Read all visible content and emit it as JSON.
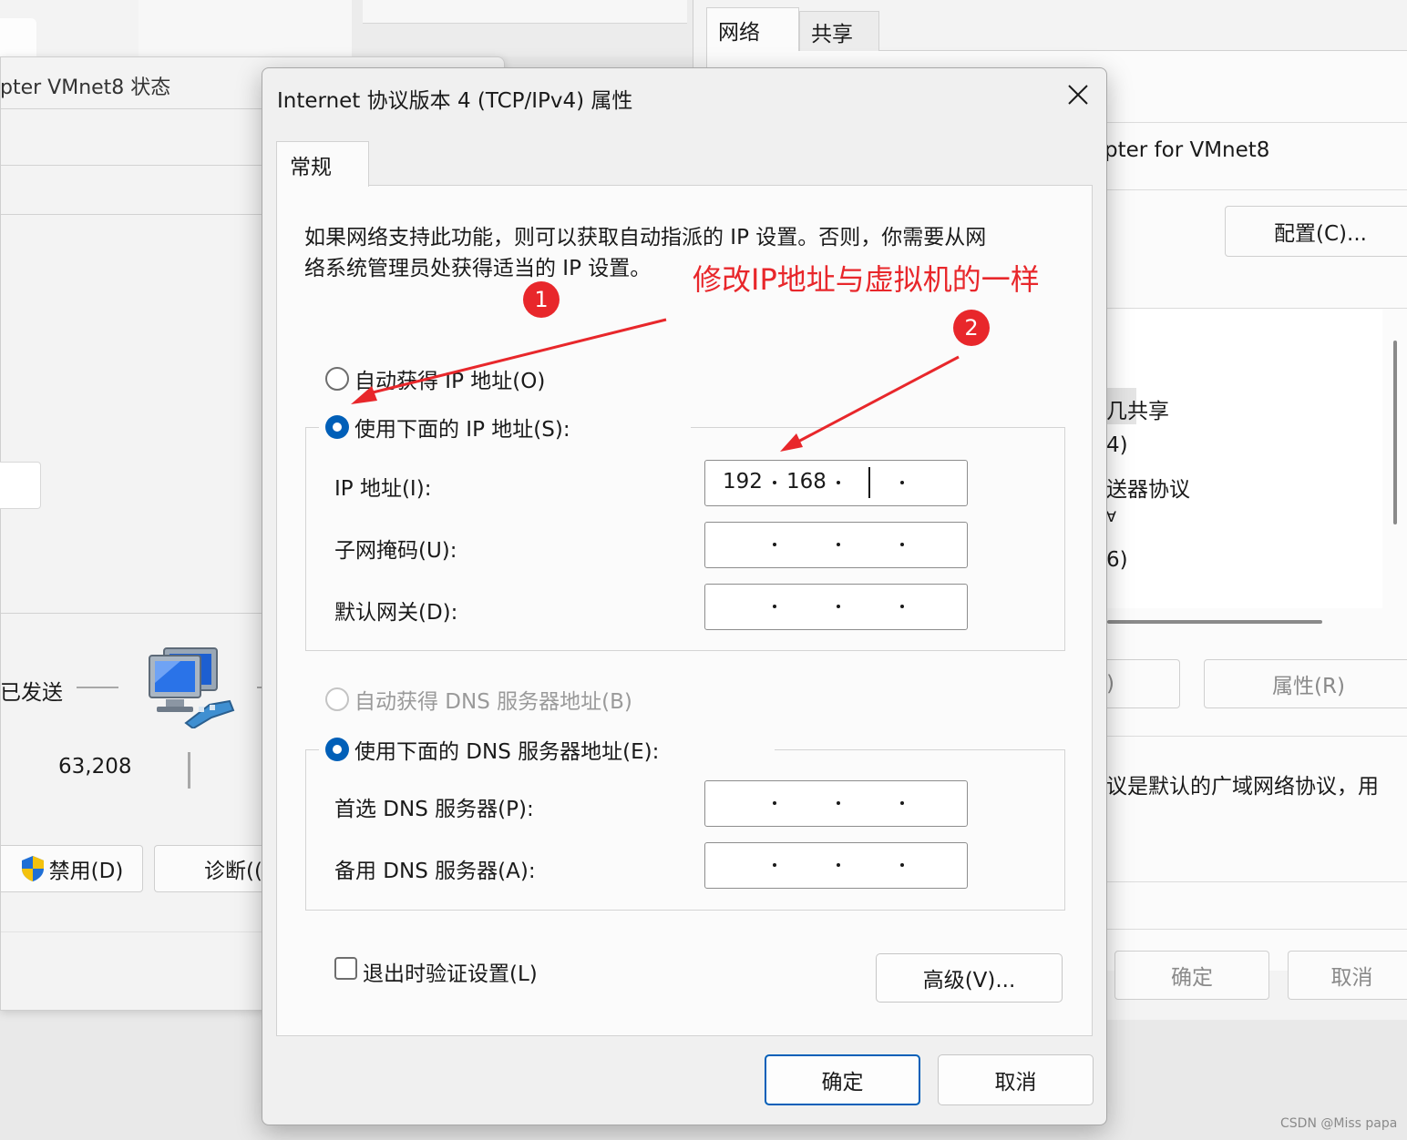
{
  "background_left": {
    "title": "pter VMnet8 状态",
    "sent_label": "已发送",
    "bytes_sent": "63,208",
    "disable_button": "禁用(D)",
    "diagnose_button": "诊断(("
  },
  "background_right": {
    "tabs": [
      "网络",
      "共享"
    ],
    "adapter_name": "pter for VMnet8",
    "configure_button": "配置(C)...",
    "list_items": [
      "几共享",
      "4)",
      "送器协议",
      "Ɐ",
      "6)"
    ],
    "paren_fragment": ")",
    "properties_button": "属性(R)",
    "description_fragment": "议是默认的广域网络协议，用",
    "ok_button": "确定",
    "cancel_button": "取消"
  },
  "dialog": {
    "title": "Internet 协议版本 4 (TCP/IPv4) 属性",
    "tab_general": "常规",
    "description_line1": "如果网络支持此功能，则可以获取自动指派的 IP 设置。否则，你需要从网",
    "description_line2": "络系统管理员处获得适当的 IP 设置。",
    "radio_auto_ip": "自动获得 IP 地址(O)",
    "radio_manual_ip": "使用下面的 IP 地址(S):",
    "ip_address_label": "IP 地址(I):",
    "ip_address_octets": [
      "192",
      "168",
      "",
      ""
    ],
    "subnet_mask_label": "子网掩码(U):",
    "default_gateway_label": "默认网关(D):",
    "radio_auto_dns": "自动获得 DNS 服务器地址(B)",
    "radio_manual_dns": "使用下面的 DNS 服务器地址(E):",
    "preferred_dns_label": "首选 DNS 服务器(P):",
    "alternate_dns_label": "备用 DNS 服务器(A):",
    "validate_on_exit_label": "退出时验证设置(L)",
    "validate_on_exit_checked": false,
    "advanced_button": "高级(V)...",
    "ok_button": "确定",
    "cancel_button": "取消"
  },
  "annotation": {
    "text": "修改IP地址与虚拟机的一样",
    "badge1": "1",
    "badge2": "2",
    "color": "#e8272b"
  },
  "watermark": "CSDN @Miss papa",
  "colors": {
    "accent": "#005fb8",
    "annotation": "#e8272b"
  }
}
